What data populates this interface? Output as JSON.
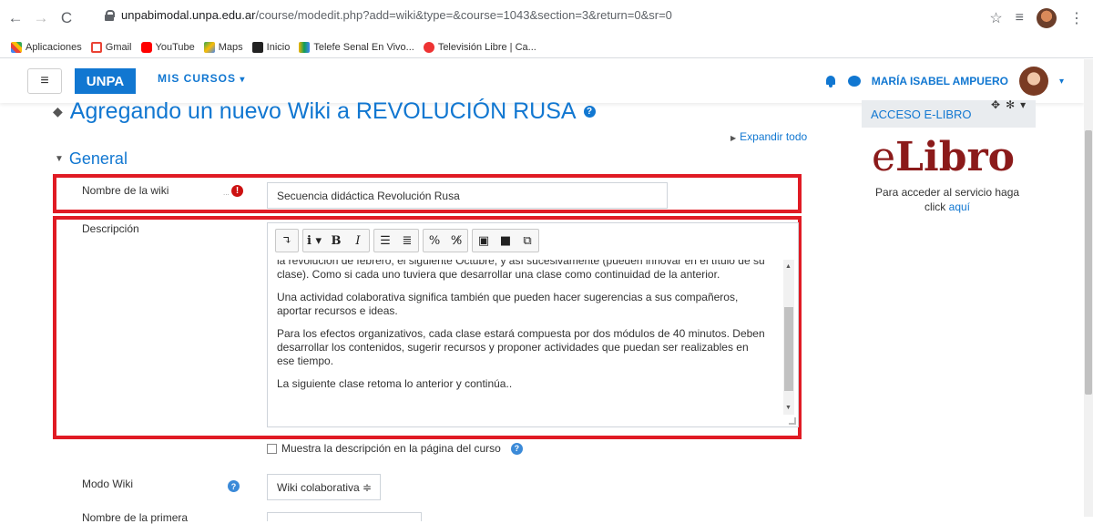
{
  "browser": {
    "url_host": "unpabimodal.unpa.edu.ar",
    "url_path": "/course/modedit.php?add=wiki&type=&course=1043&section=3&return=0&sr=0",
    "bookmarks": [
      "Aplicaciones",
      "Gmail",
      "YouTube",
      "Maps",
      "Inicio",
      "Telefe Senal En Vivo...",
      "Televisión Libre | Ca..."
    ]
  },
  "navbar": {
    "brand": "UNPA",
    "mis_cursos": "MIS CURSOS",
    "user_name": "MARÍA ISABEL AMPUERO"
  },
  "page": {
    "title": "Agregando un nuevo Wiki a REVOLUCIÓN RUSA",
    "expand_all": "Expandir todo",
    "section": "General"
  },
  "form": {
    "wiki_name_label": "Nombre de la wiki",
    "wiki_name_value": "Secuencia didáctica Revolución Rusa",
    "description_label": "Descripción",
    "description_paragraphs": [
      "la revolución de febrero, el siguiente Octubre, y así sucesivamente (pueden innovar en el título de su clase). Como si cada uno tuviera que desarrollar una clase como continuidad de la anterior.",
      "Una actividad colaborativa significa también que pueden hacer sugerencias a sus compañeros, aportar recursos e ideas.",
      "Para los efectos organizativos, cada clase estará compuesta por dos módulos de 40 minutos. Deben desarrollar los contenidos, sugerir recursos y proponer actividades que puedan ser realizables en ese tiempo.",
      "La siguiente clase retoma lo anterior y continúa.."
    ],
    "show_description_label": "Muestra la descripción en la página del curso",
    "wiki_mode_label": "Modo Wiki",
    "wiki_mode_value": "Wiki colaborativa ≑",
    "next_label_partial": "Nombre de la primera"
  },
  "sidebar_block": {
    "header": "ACCESO E-LIBRO",
    "logo_e": "e",
    "logo_rest": "Libro",
    "text": "Para acceder al servicio haga click",
    "link": "aquí"
  },
  "colors": {
    "accent": "#1177d1",
    "highlight": "#e01b24",
    "logo": "#8b1a1a"
  }
}
